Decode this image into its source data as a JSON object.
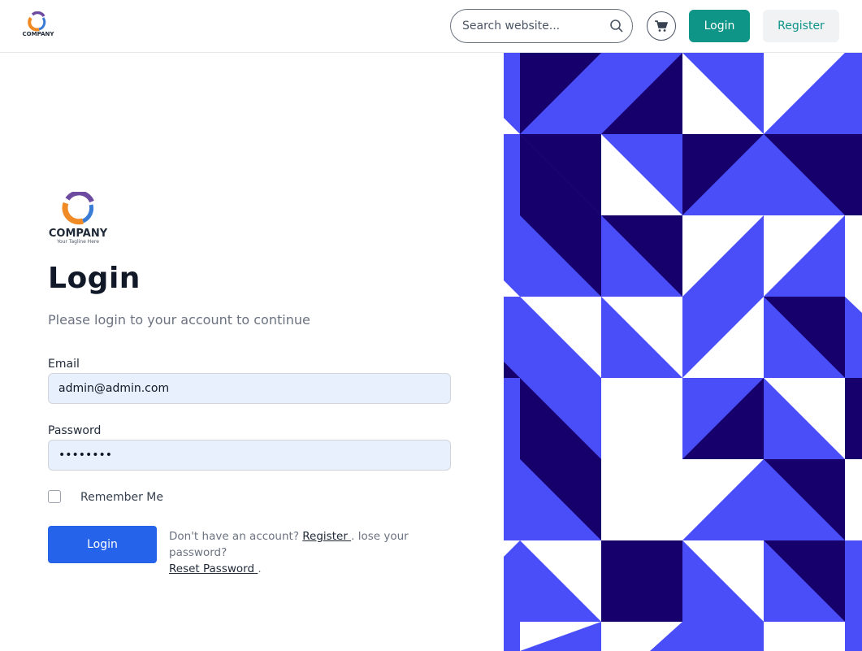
{
  "header": {
    "logo_icon": "company-logo",
    "logo_text": "COMPANY",
    "logo_tagline": "Your Tagline Here",
    "search": {
      "placeholder": "Search website...",
      "value": "",
      "icon": "search-icon"
    },
    "cart_icon": "cart-icon",
    "login_label": "Login",
    "register_label": "Register"
  },
  "form": {
    "logo_text": "COMPANY",
    "logo_tagline": "Your Tagline Here",
    "title": "Login",
    "subtitle": "Please login to your account to continue",
    "email_label": "Email",
    "email_value": "admin@admin.com",
    "password_label": "Password",
    "password_value": "password",
    "remember_label": "Remember Me",
    "remember_checked": false,
    "submit_label": "Login",
    "no_account_text": "Don't have an account? ",
    "register_link": "Register ",
    "lost_password_text": ". lose your password? ",
    "reset_link": "Reset Password ",
    "end_text": "."
  },
  "colors": {
    "primary_button": "#2563eb",
    "teal": "#0f9488",
    "pattern_light": "#4a4ef8",
    "pattern_dark": "#16006b",
    "pattern_white": "#ffffff"
  }
}
